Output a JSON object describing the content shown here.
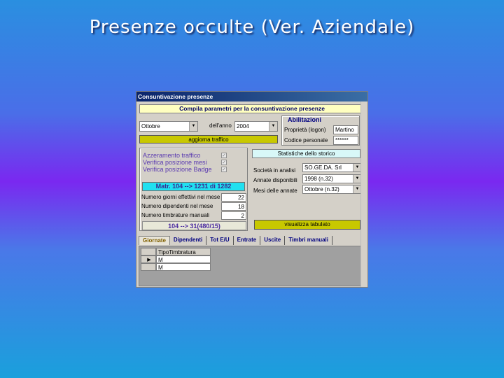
{
  "slide": {
    "title": "Presenze occulte (Ver. Aziendale)"
  },
  "window": {
    "title": "Consuntivazione presenze",
    "banner": "Compila parametri per la consuntivazione presenze"
  },
  "period": {
    "month_value": "Ottobre",
    "year_label": "dell'anno",
    "year_value": "2004",
    "update_button": "aggiorna traffico"
  },
  "abilitazioni": {
    "title": "Abilitazioni",
    "owner_label": "Proprietà (logon)",
    "owner_value": "Martino",
    "code_label": "Codice personale",
    "code_value": "******"
  },
  "checks": {
    "items": [
      {
        "label": "Azzeramento traffico",
        "mark": "✓"
      },
      {
        "label": "Verifica posizione mesi",
        "mark": "✓"
      },
      {
        "label": "Verifica posizione Badge",
        "mark": "✓"
      }
    ],
    "matr_box": "Matr. 104 --> 1231 di 1282",
    "stats": [
      {
        "label": "Numero giorni effettivi nel mese",
        "value": "22"
      },
      {
        "label": "Numero dipendenti nel mese",
        "value": "18"
      },
      {
        "label": "Numero timbrature manuali",
        "value": "2"
      }
    ],
    "progress_box": "104 --> 31(480/15)"
  },
  "storico": {
    "title": "Statistiche dello storico",
    "company_label": "Società in analisi",
    "company_value": "SO.GE.DA. Srl",
    "years_label": "Annate disponibili",
    "years_value": "1998 (n.32)",
    "months_label": "Mesi delle annate",
    "months_value": "Ottobre (n.32)",
    "view_button": "visualizza tabulato"
  },
  "tabs": [
    "Giornate",
    "Dipendenti",
    "Tot E/U",
    "Entrate",
    "Uscite",
    "Timbri manuali"
  ],
  "grid": {
    "header": "TipoTimbratura",
    "rows": [
      "M",
      "M"
    ]
  }
}
